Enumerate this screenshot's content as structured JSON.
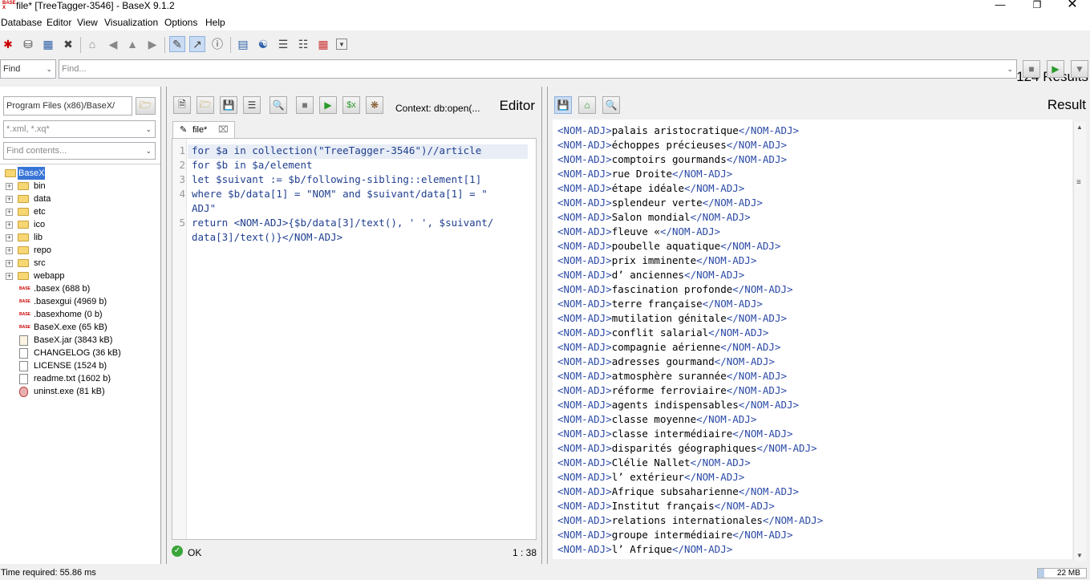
{
  "window": {
    "title": "file* [TreeTagger-3546] - BaseX 9.1.2"
  },
  "menu": [
    "Database",
    "Editor",
    "View",
    "Visualization",
    "Options",
    "Help"
  ],
  "results_count": "124 Results",
  "find": {
    "mode": "Find",
    "placeholder": "Find..."
  },
  "explorer": {
    "path": "Program Files (x86)/BaseX/",
    "filter_placeholder": "*.xml, *.xq*",
    "contents_placeholder": "Find contents...",
    "tree": [
      {
        "name": "BaseX",
        "type": "root"
      },
      {
        "name": "bin",
        "type": "folder"
      },
      {
        "name": "data",
        "type": "folder"
      },
      {
        "name": "etc",
        "type": "folder"
      },
      {
        "name": "ico",
        "type": "folder"
      },
      {
        "name": "lib",
        "type": "folder"
      },
      {
        "name": "repo",
        "type": "folder"
      },
      {
        "name": "src",
        "type": "folder"
      },
      {
        "name": "webapp",
        "type": "folder"
      },
      {
        "name": ".basex (688 b)",
        "type": "basex"
      },
      {
        "name": ".basexgui (4969 b)",
        "type": "basex"
      },
      {
        "name": ".basexhome (0 b)",
        "type": "basex"
      },
      {
        "name": "BaseX.exe (65 kB)",
        "type": "basex"
      },
      {
        "name": "BaseX.jar (3843 kB)",
        "type": "jar"
      },
      {
        "name": "CHANGELOG (36 kB)",
        "type": "file"
      },
      {
        "name": "LICENSE (1524 b)",
        "type": "file"
      },
      {
        "name": "readme.txt (1602 b)",
        "type": "file"
      },
      {
        "name": "uninst.exe (81 kB)",
        "type": "exe"
      }
    ]
  },
  "editor": {
    "title": "Editor",
    "context": "Context: db:open(...",
    "tab": "file*",
    "lines": [
      {
        "num": "1",
        "text": "for $a in collection(\"TreeTagger-3546\")//article"
      },
      {
        "num": "2",
        "text": "for $b in $a/element"
      },
      {
        "num": "3",
        "text": "let $suivant := $b/following-sibling::element[1]"
      },
      {
        "num": "4",
        "text": "where $b/data[1] = \"NOM\" and $suivant/data[1] = \""
      },
      {
        "num": "",
        "text": "ADJ\""
      },
      {
        "num": "5",
        "text": "return <NOM-ADJ>{$b/data[3]/text(), ' ', $suivant/"
      },
      {
        "num": "",
        "text": "data[3]/text()}</NOM-ADJ>"
      }
    ],
    "status": "OK",
    "cursor": "1 : 38"
  },
  "result": {
    "title": "Result",
    "open_tag": "<NOM-ADJ>",
    "close_tag": "</NOM-ADJ>",
    "items": [
      "palais aristocratique",
      "échoppes précieuses",
      "comptoirs gourmands",
      "rue Droite",
      "étape idéale",
      "splendeur verte",
      "Salon mondial",
      "fleuve «",
      "poubelle aquatique",
      "prix imminente",
      "d’ anciennes",
      "fascination profonde",
      "terre française",
      "mutilation génitale",
      "conflit salarial",
      "compagnie aérienne",
      "adresses gourmand",
      "atmosphère surannée",
      "réforme ferroviaire",
      "agents indispensables",
      "classe moyenne",
      "classe intermédiaire",
      "disparités géographiques",
      "Clélie Nallet",
      "l’ extérieur",
      "Afrique subsaharienne",
      "Institut français",
      "relations internationales",
      "groupe intermédiaire",
      "l’ Afrique"
    ]
  },
  "status_bar": {
    "time": "Time required: 55.86 ms",
    "memory": "22 MB"
  }
}
